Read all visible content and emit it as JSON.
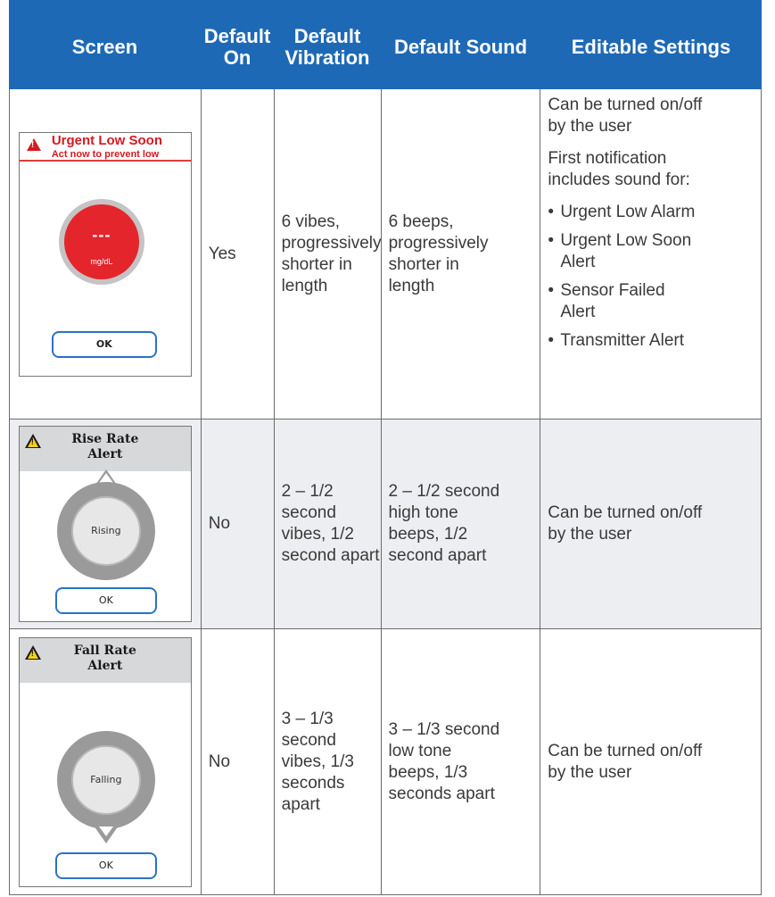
{
  "headers": {
    "screen": "Screen",
    "default_on": [
      "Default",
      "On"
    ],
    "default_vibration": [
      "Default",
      "Vibration"
    ],
    "default_sound": "Default Sound",
    "editable_settings": "Editable Settings"
  },
  "rows": [
    {
      "screen": {
        "title": "Urgent Low Soon",
        "subtitle": "Act now to prevent low",
        "reading": "---",
        "unit": "mg/dL",
        "button": "OK",
        "icon": "warning-red-icon"
      },
      "default_on": "Yes",
      "vibration": [
        "6 vibes,",
        "progressively",
        "shorter in",
        "length"
      ],
      "sound": [
        "6 beeps,",
        "progressively",
        "shorter in",
        "length"
      ],
      "editable": {
        "para1": [
          "Can be turned on/off",
          "by the user"
        ],
        "para2": [
          "First notification",
          "includes sound for:"
        ],
        "bullets": [
          [
            "Urgent Low Alarm"
          ],
          [
            "Urgent Low Soon",
            "Alert"
          ],
          [
            "Sensor Failed",
            "Alert"
          ],
          [
            "Transmitter Alert"
          ]
        ]
      }
    },
    {
      "screen": {
        "title": [
          "Rise Rate",
          "Alert"
        ],
        "label": "Rising",
        "button": "OK",
        "icon": "warning-yellow-icon"
      },
      "default_on": "No",
      "vibration": [
        "2 – 1/2",
        "second",
        "vibes, 1/2",
        "second apart"
      ],
      "sound": [
        "2 – 1/2 second",
        "high tone",
        "beeps, 1/2",
        "second apart"
      ],
      "editable": [
        "Can be turned on/off",
        "by the user"
      ]
    },
    {
      "screen": {
        "title": [
          "Fall Rate",
          "Alert"
        ],
        "label": "Falling",
        "button": "OK",
        "icon": "warning-yellow-icon"
      },
      "default_on": "No",
      "vibration": [
        "3 – 1/3",
        "second",
        "vibes, 1/3",
        "seconds",
        "apart"
      ],
      "sound": [
        "3 – 1/3 second",
        "low tone",
        "beeps, 1/3",
        "seconds apart"
      ],
      "editable": [
        "Can be turned on/off",
        "by the user"
      ]
    }
  ],
  "colors": {
    "header_bg": "#1e69b6",
    "alt_row_bg": "#edeef1",
    "urgent_red": "#d71920",
    "button_border": "#2a72c7",
    "warning_yellow": "#f4d01b"
  }
}
